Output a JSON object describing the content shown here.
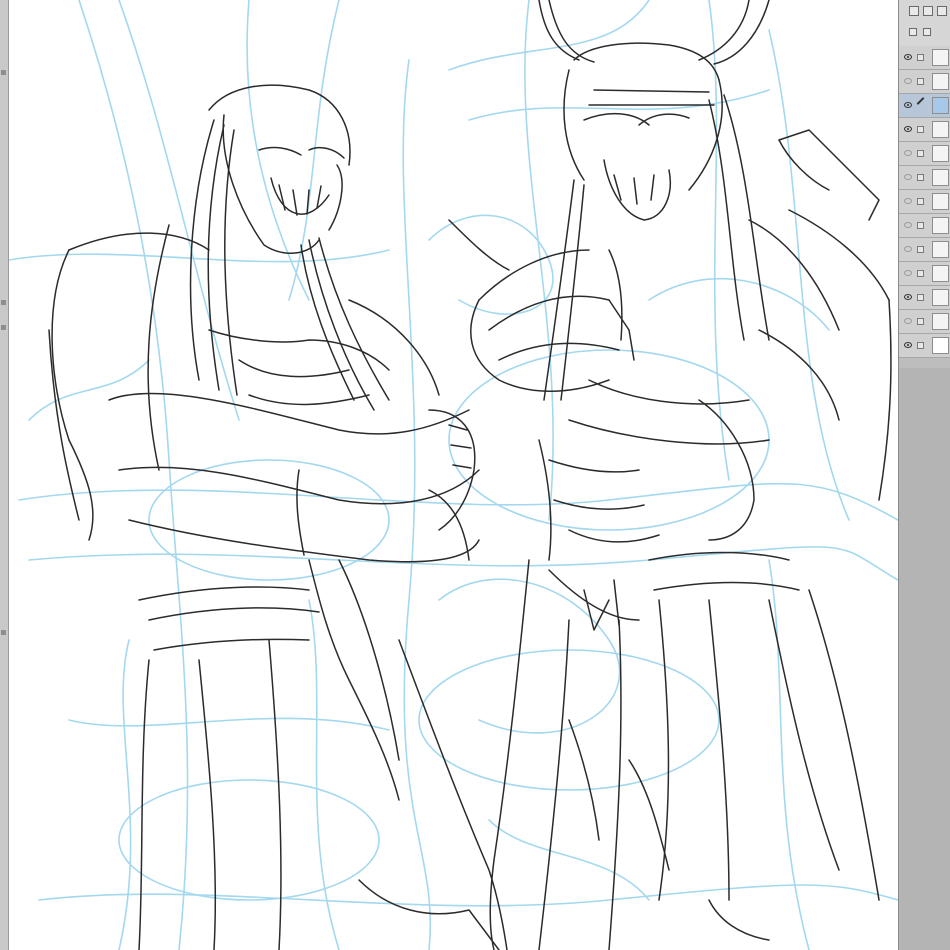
{
  "app": {
    "window_type": "drawing canvas",
    "tool_strip": {
      "icons": [
        "tool-icon",
        "tool-icon",
        "tool-icon",
        "tool-icon"
      ]
    }
  },
  "canvas": {
    "content": "sketch",
    "line_colors": {
      "ink": "#2b2b2b",
      "rough_sketch": "#9fd6ee"
    }
  },
  "layer_panel": {
    "toolbar_icons": [
      "layer-settings-icon",
      "layer-lock-icon",
      "new-folder-icon"
    ],
    "layers": [
      {
        "visible": true,
        "selected": false,
        "editing": false,
        "thumb": "light"
      },
      {
        "visible": false,
        "selected": false,
        "editing": false,
        "thumb": "light"
      },
      {
        "visible": true,
        "selected": true,
        "editing": true,
        "thumb": "selected"
      },
      {
        "visible": true,
        "selected": false,
        "editing": false,
        "thumb": "light"
      },
      {
        "visible": false,
        "selected": false,
        "editing": false,
        "thumb": "light"
      },
      {
        "visible": false,
        "selected": false,
        "editing": false,
        "thumb": "light"
      },
      {
        "visible": false,
        "selected": false,
        "editing": false,
        "thumb": "light"
      },
      {
        "visible": false,
        "selected": false,
        "editing": false,
        "thumb": "light"
      },
      {
        "visible": false,
        "selected": false,
        "editing": false,
        "thumb": "light"
      },
      {
        "visible": false,
        "selected": false,
        "editing": false,
        "thumb": "light"
      },
      {
        "visible": true,
        "selected": false,
        "editing": false,
        "thumb": "light"
      },
      {
        "visible": false,
        "selected": false,
        "editing": false,
        "thumb": "light"
      },
      {
        "visible": true,
        "selected": false,
        "editing": false,
        "thumb": "white"
      }
    ],
    "colors": {
      "panel": "#bdbdbd",
      "selected_row": "#b7c6d8"
    }
  }
}
